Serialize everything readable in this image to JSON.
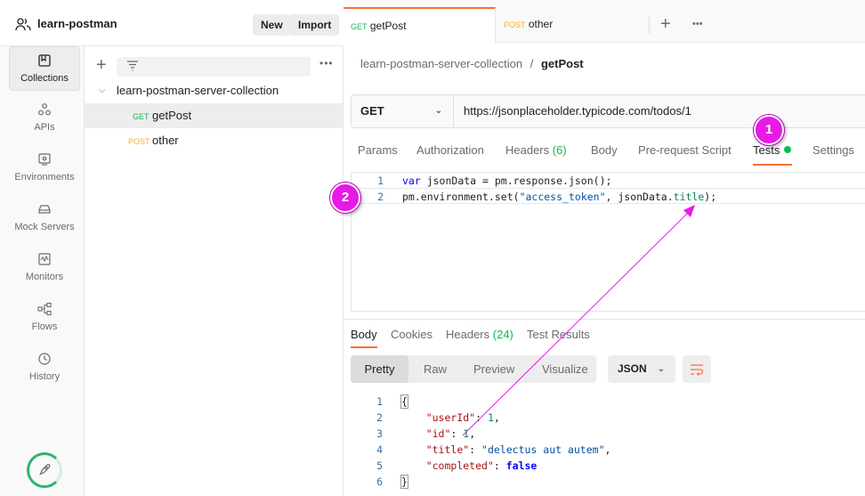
{
  "workspace": {
    "name": "learn-postman",
    "new_label": "New",
    "import_label": "Import"
  },
  "rail": {
    "items": [
      {
        "label": "Collections",
        "icon": "collections-icon"
      },
      {
        "label": "APIs",
        "icon": "apis-icon"
      },
      {
        "label": "Environments",
        "icon": "environments-icon"
      },
      {
        "label": "Mock Servers",
        "icon": "mock-servers-icon"
      },
      {
        "label": "Monitors",
        "icon": "monitors-icon"
      },
      {
        "label": "Flows",
        "icon": "flows-icon"
      },
      {
        "label": "History",
        "icon": "history-icon"
      }
    ]
  },
  "sidebar": {
    "collection": "learn-postman-server-collection",
    "requests": [
      {
        "method": "GET",
        "name": "getPost"
      },
      {
        "method": "POST",
        "name": "other"
      }
    ]
  },
  "tabs": [
    {
      "method": "GET",
      "name": "getPost"
    },
    {
      "method": "POST",
      "name": "other"
    }
  ],
  "breadcrumb": {
    "collection": "learn-postman-server-collection",
    "separator": "/",
    "request": "getPost"
  },
  "request": {
    "method": "GET",
    "url": "https://jsonplaceholder.typicode.com/todos/1",
    "tabs": {
      "params": "Params",
      "authorization": "Authorization",
      "headers": "Headers",
      "headers_count": "(6)",
      "body": "Body",
      "prerequest": "Pre-request Script",
      "tests": "Tests",
      "settings": "Settings"
    }
  },
  "editor": {
    "line_numbers": [
      "1",
      "2"
    ],
    "line1": {
      "kw": "var",
      "rest": " jsonData = pm.response.json();"
    },
    "line2": {
      "a": "pm.environment.set(",
      "str": "\"access_token\"",
      "b": ", jsonData.",
      "teal": "title",
      "c": ");"
    }
  },
  "response": {
    "tabs": {
      "body": "Body",
      "cookies": "Cookies",
      "headers": "Headers",
      "headers_count": "(24)",
      "test_results": "Test Results"
    },
    "views": {
      "pretty": "Pretty",
      "raw": "Raw",
      "preview": "Preview",
      "visualize": "Visualize"
    },
    "format": "JSON",
    "line_numbers": [
      "1",
      "2",
      "3",
      "4",
      "5",
      "6"
    ],
    "json": {
      "open": "{",
      "k1": "\"userId\"",
      "v1": "1",
      "k2": "\"id\"",
      "v2": "1",
      "k3": "\"title\"",
      "v3": "\"delectus aut autem\"",
      "k4": "\"completed\"",
      "v4": "false",
      "close": "}"
    }
  },
  "annotations": {
    "badge1": "1",
    "badge2": "2",
    "color": "#e619e6"
  }
}
